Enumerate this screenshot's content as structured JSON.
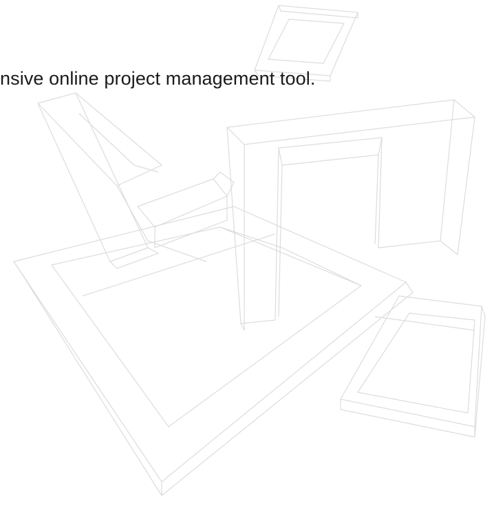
{
  "slide": {
    "caption": "nsive online project management tool."
  },
  "graphic": {
    "name": "abstract-3d-frames-watermark",
    "stroke_color": "#dcdcdc"
  }
}
